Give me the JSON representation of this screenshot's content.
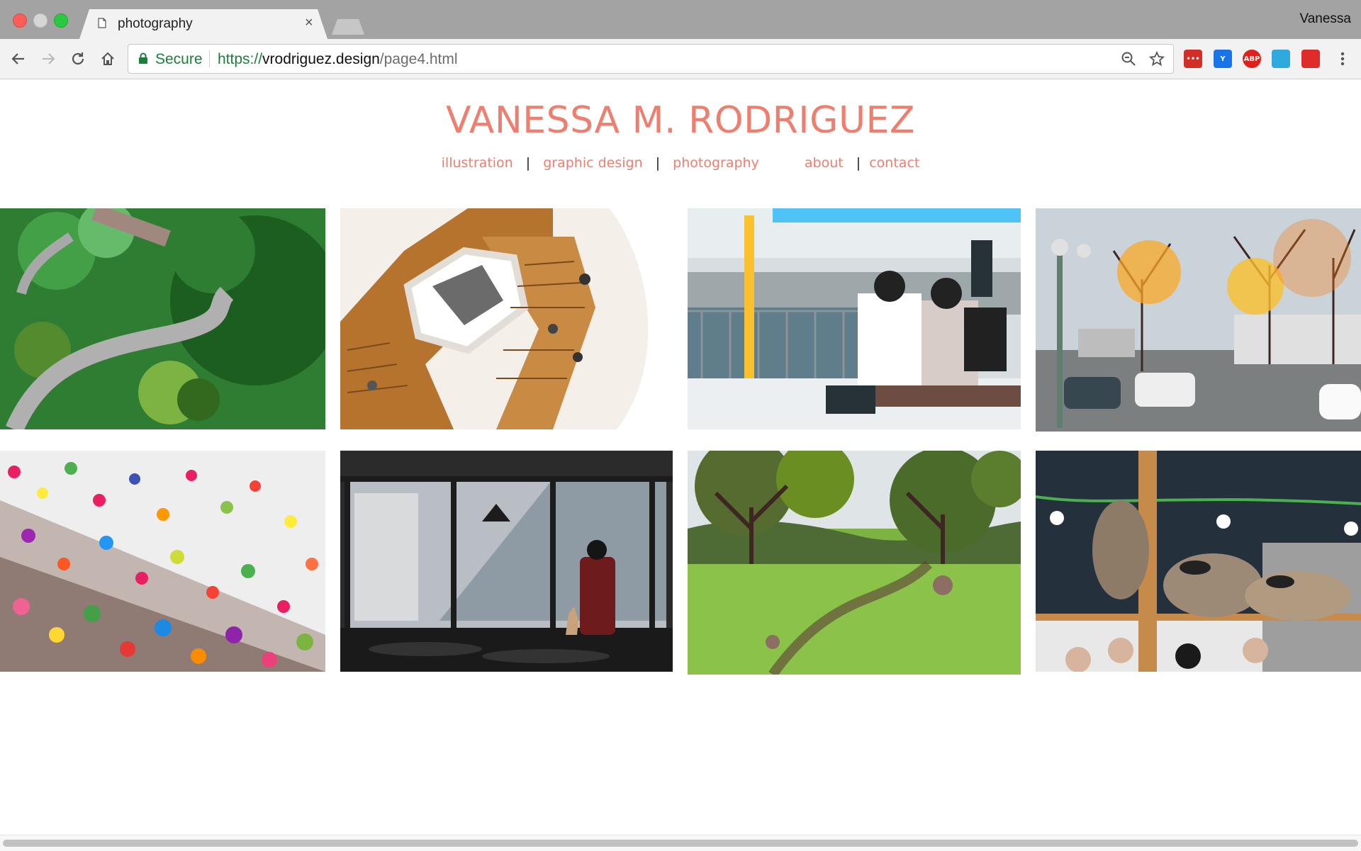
{
  "browser": {
    "tab_title": "photography",
    "tab_close": "×",
    "profile_name": "Vanessa",
    "secure_label": "Secure",
    "url_scheme": "https://",
    "url_host": "vrodriguez.design",
    "url_path": "/page4.html",
    "extensions": [
      {
        "name": "lastpass-extension",
        "label": "•••",
        "color": "#d32d27"
      },
      {
        "name": "vimeo-extension",
        "label": "Y",
        "color": "#1a73e8"
      },
      {
        "name": "adblock-plus-extension",
        "label": "ABP",
        "color": "#e0201b"
      },
      {
        "name": "rocket-extension",
        "label": "",
        "color": "#30a9de"
      },
      {
        "name": "media-extension",
        "label": "",
        "color": "#e02b2b"
      }
    ]
  },
  "site": {
    "title": "VANESSA M. RODRIGUEZ",
    "accent_color": "#f07e6e",
    "nav": {
      "illustration": "illustration",
      "graphic_design": "graphic design",
      "photography": "photography",
      "about": "about",
      "contact": "contact",
      "separator": "|"
    }
  },
  "gallery": {
    "photos": [
      {
        "name": "photo-garden-aerial"
      },
      {
        "name": "photo-spiral-staircase"
      },
      {
        "name": "photo-subway-platform"
      },
      {
        "name": "photo-autumn-street"
      },
      {
        "name": "photo-hanging-flowers"
      },
      {
        "name": "photo-cafe-window"
      },
      {
        "name": "photo-green-field"
      },
      {
        "name": "photo-raccoon-cafe"
      }
    ]
  }
}
